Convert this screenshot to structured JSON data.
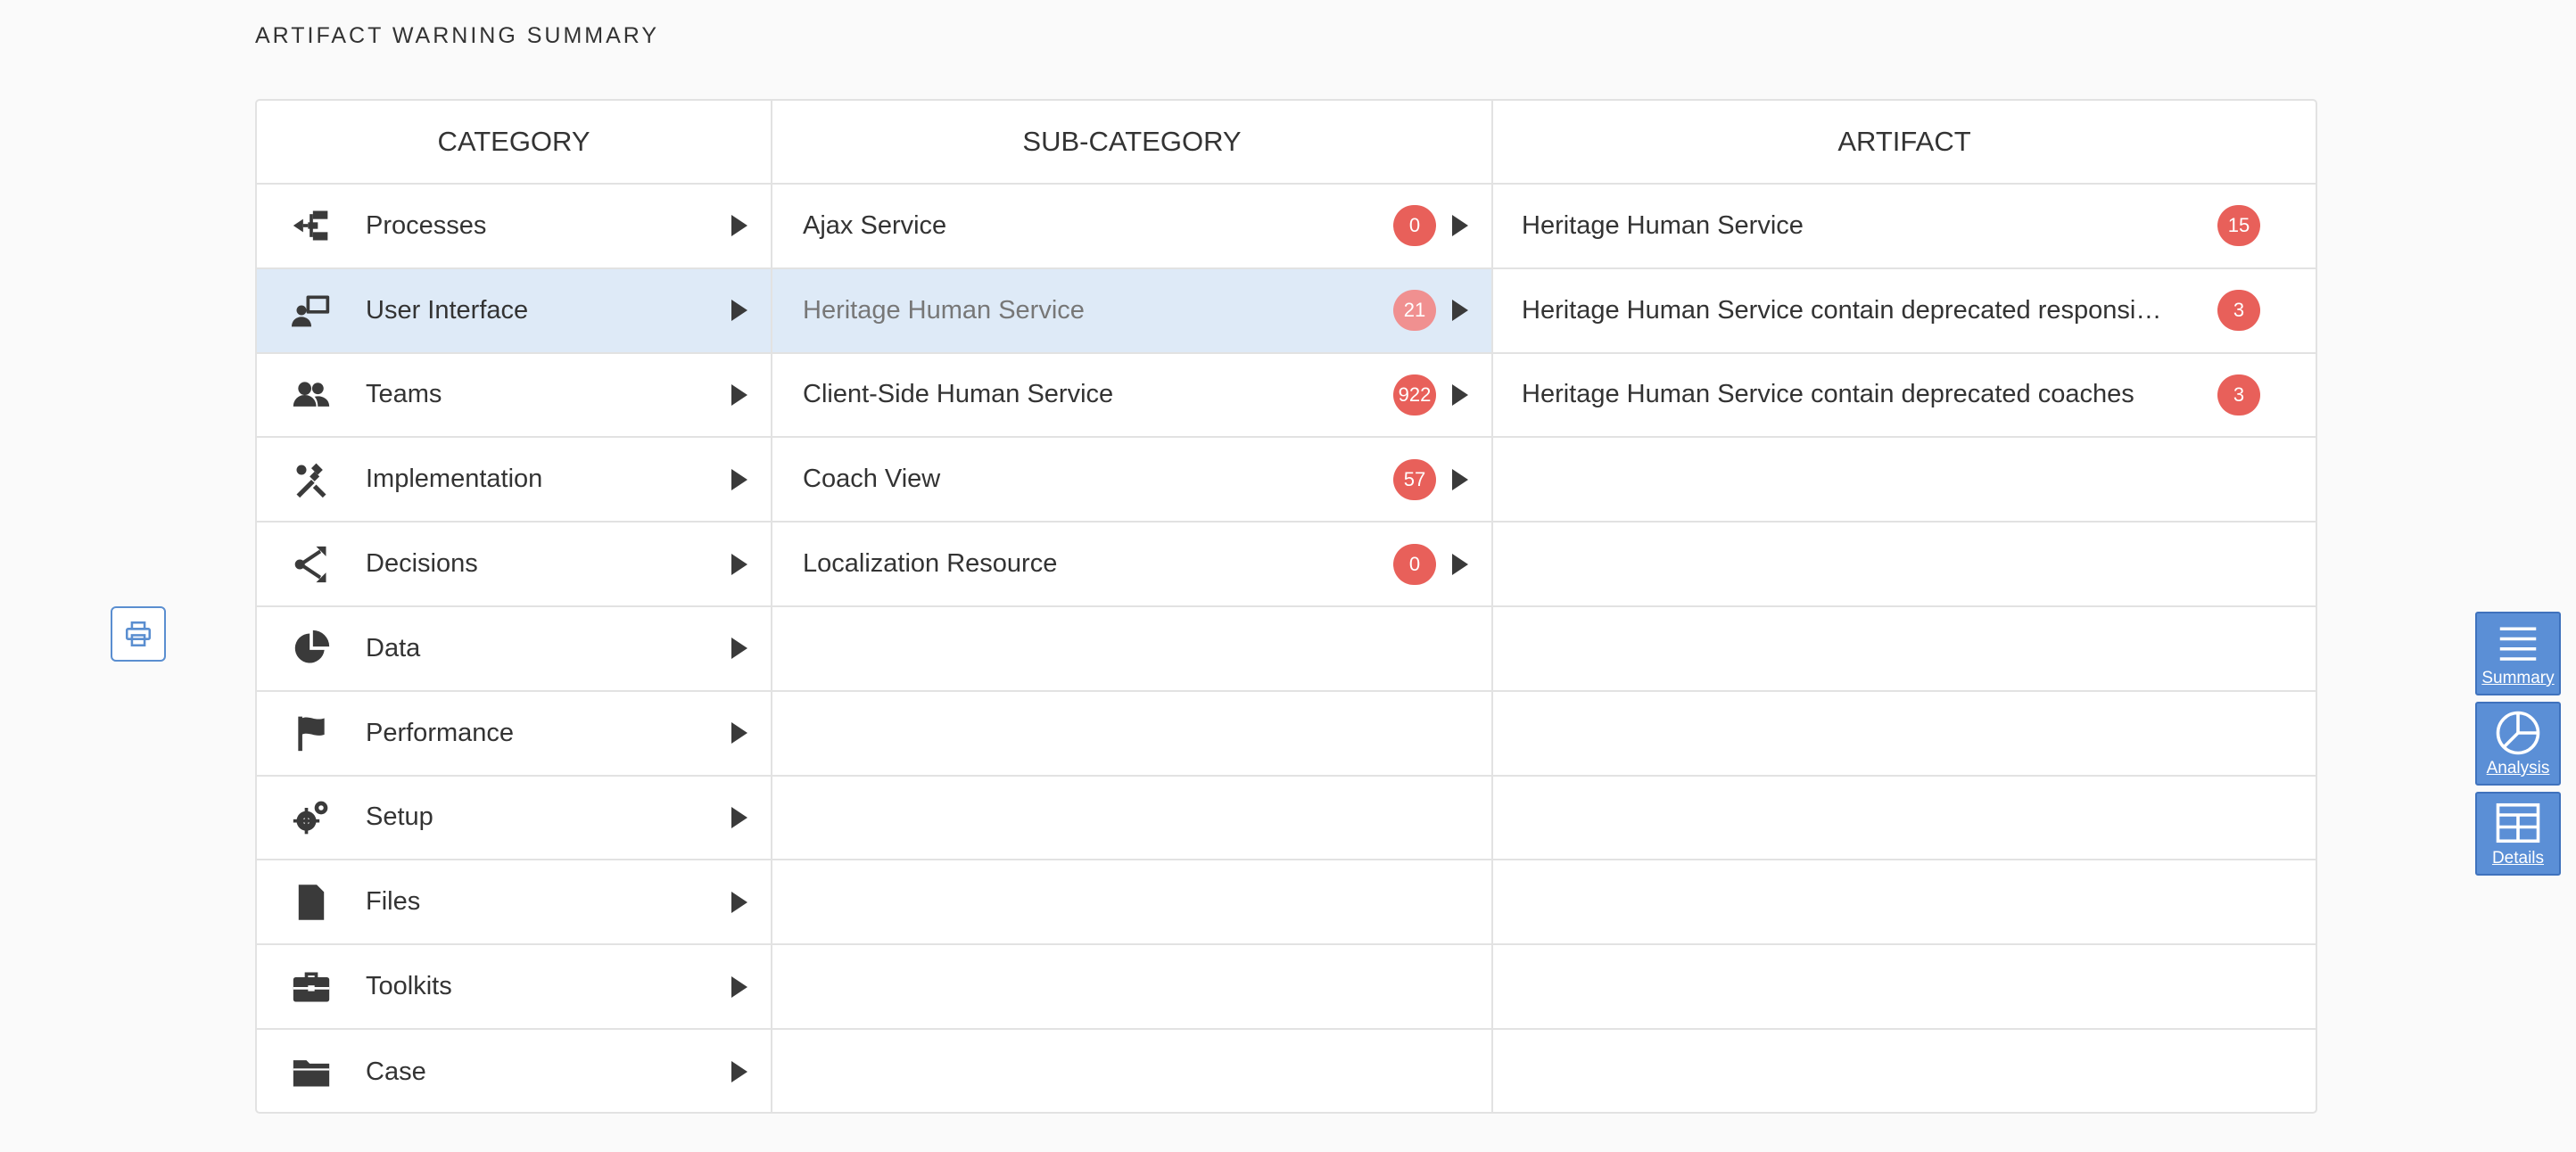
{
  "page": {
    "title": "ARTIFACT WARNING SUMMARY"
  },
  "columns": {
    "category": "CATEGORY",
    "subcategory": "SUB-CATEGORY",
    "artifact": "ARTIFACT"
  },
  "categories": [
    {
      "label": "Processes",
      "icon": "processes-icon"
    },
    {
      "label": "User Interface",
      "icon": "user-interface-icon",
      "selected": true
    },
    {
      "label": "Teams",
      "icon": "teams-icon"
    },
    {
      "label": "Implementation",
      "icon": "implementation-icon"
    },
    {
      "label": "Decisions",
      "icon": "decisions-icon"
    },
    {
      "label": "Data",
      "icon": "data-icon"
    },
    {
      "label": "Performance",
      "icon": "flag-icon"
    },
    {
      "label": "Setup",
      "icon": "gears-icon"
    },
    {
      "label": "Files",
      "icon": "file-icon"
    },
    {
      "label": "Toolkits",
      "icon": "briefcase-icon"
    },
    {
      "label": "Case",
      "icon": "folder-icon"
    }
  ],
  "subcategories": [
    {
      "label": "Ajax Service",
      "count": "0"
    },
    {
      "label": "Heritage Human Service",
      "count": "21",
      "selected": true
    },
    {
      "label": "Client-Side Human Service",
      "count": "922"
    },
    {
      "label": "Coach View",
      "count": "57"
    },
    {
      "label": "Localization Resource",
      "count": "0"
    }
  ],
  "artifacts": [
    {
      "label": "Heritage Human Service",
      "count": "15"
    },
    {
      "label": "Heritage Human Service contain deprecated responsi…",
      "count": "3"
    },
    {
      "label": "Heritage Human Service contain deprecated coaches",
      "count": "3"
    }
  ],
  "side_nav": {
    "summary": "Summary",
    "analysis": "Analysis",
    "details": "Details"
  },
  "colors": {
    "badge": "#e8605a",
    "selected_row": "#deeaf7",
    "side_nav": "#5b8fd6"
  }
}
